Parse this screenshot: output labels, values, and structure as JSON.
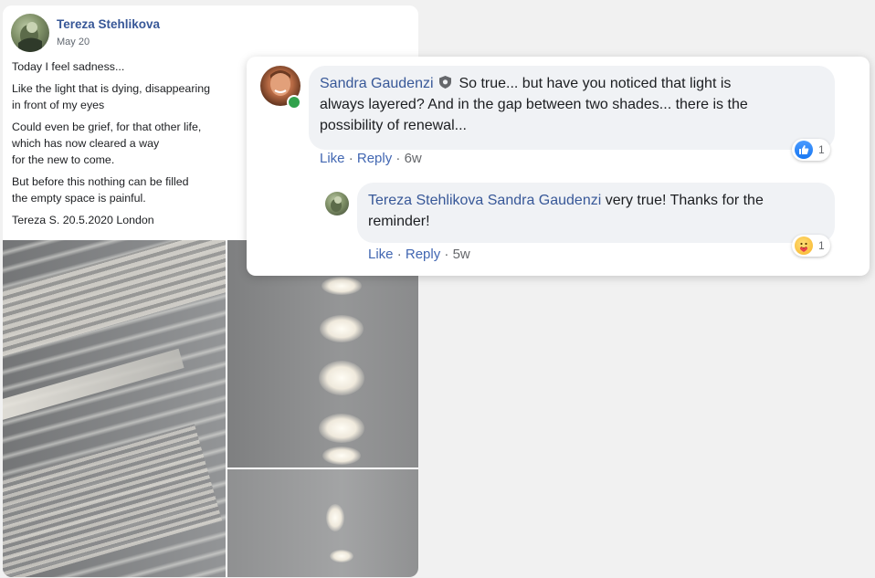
{
  "post": {
    "author": "Tereza Stehlikova",
    "date": "May 20",
    "paragraphs": [
      "Today I feel sadness...",
      "Like the light that is dying, disappearing in front of my eyes",
      "Could even be grief, for that other life, which has now cleared a way for the new to come.",
      "But before this nothing can be filled the empty space is painful."
    ],
    "lines": {
      "p1": "Today I feel sadness...",
      "p2a": "Like the light that is dying, disappearing",
      "p2b": "in front of my eyes",
      "p3a": "Could even be grief, for that other life,",
      "p3b": "which has now cleared a way",
      "p3c": "for the new to come.",
      "p4a": "But before this nothing can be filled",
      "p4b": "the empty space is painful.",
      "signature": "Tereza S. 20.5.2020 London"
    }
  },
  "comments": [
    {
      "author": "Sandra Gaudenzi",
      "text": "So true... but have you noticed that light is always layered? And in the gap between two shades... there is the possibility of renewal...",
      "lines": [
        "So true... but have you noticed that light is",
        "always layered? And in the gap between two shades... there is the",
        "possibility of renewal..."
      ],
      "like_label": "Like",
      "reply_label": "Reply",
      "age": "6w",
      "reaction_count": "1",
      "reaction_icon": "like-icon",
      "online": true
    },
    {
      "author": "Tereza Stehlikova",
      "mention": "Sandra Gaudenzi",
      "text": "very true! Thanks for the reminder!",
      "lines": [
        "very true! Thanks for the",
        "reminder!"
      ],
      "like_label": "Like",
      "reply_label": "Reply",
      "age": "5w",
      "reaction_count": "1",
      "reaction_icon": "care-icon"
    }
  ],
  "separator": "·",
  "colors": {
    "link": "#385898",
    "action_link": "#4267b2",
    "bubble": "#f0f2f5",
    "online": "#31a24c",
    "like": "#1877f2"
  }
}
